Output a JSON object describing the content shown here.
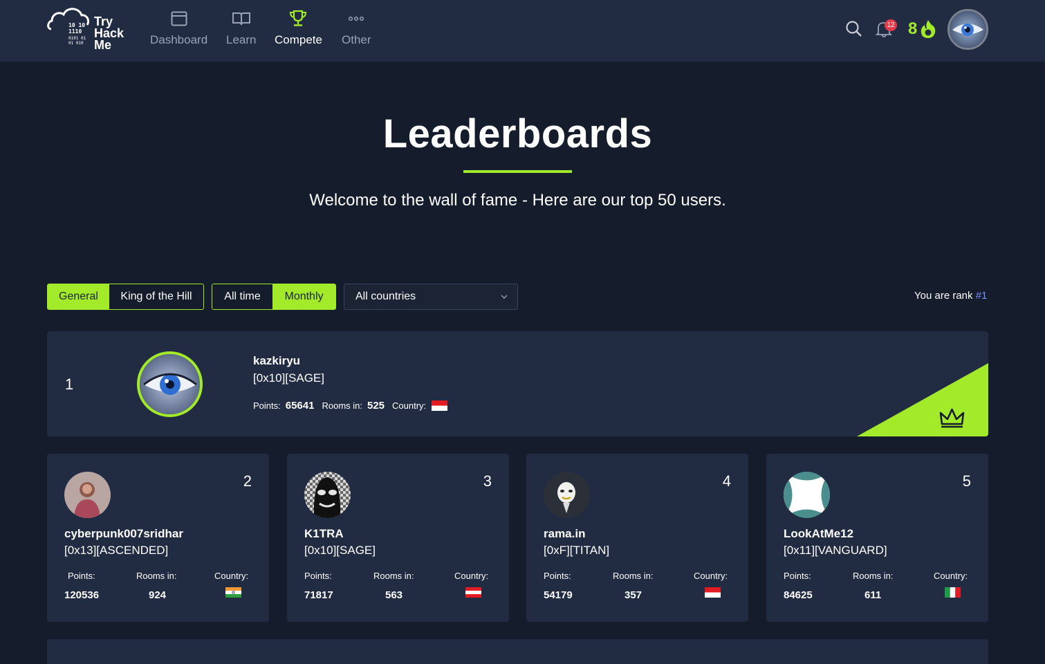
{
  "nav": {
    "logo_text": [
      "Try",
      "Hack",
      "Me"
    ],
    "items": [
      {
        "label": "Dashboard",
        "icon": "dashboard-icon",
        "active": false
      },
      {
        "label": "Learn",
        "icon": "book-icon",
        "active": false
      },
      {
        "label": "Compete",
        "icon": "trophy-icon",
        "active": true
      },
      {
        "label": "Other",
        "icon": "more-icon",
        "active": false
      }
    ],
    "notifications_count": "12",
    "streak": "8",
    "accent": "#a3ea2a"
  },
  "hero": {
    "title": "Leaderboards",
    "subtitle": "Welcome to the wall of fame - Here are our top 50 users."
  },
  "filters": {
    "type_options": [
      "General",
      "King of the Hill"
    ],
    "type_selected": "General",
    "period_options": [
      "All time",
      "Monthly"
    ],
    "period_selected": "Monthly",
    "country_selected": "All countries",
    "rank_prefix": "You are rank ",
    "rank_value": "#1"
  },
  "labels": {
    "points": "Points:",
    "rooms": "Rooms in:",
    "country": "Country:"
  },
  "leader": {
    "rank": "1",
    "username": "kazkiryu",
    "title": "[0x10][SAGE]",
    "points": "65641",
    "rooms": "525",
    "country_flag": "red-white"
  },
  "runners": [
    {
      "rank": "2",
      "username": "cyberpunk007sridhar",
      "title": "[0x13][ASCENDED]",
      "points": "120536",
      "rooms": "924",
      "country_flag": "india"
    },
    {
      "rank": "3",
      "username": "K1TRA",
      "title": "[0x10][SAGE]",
      "points": "71817",
      "rooms": "563",
      "country_flag": "austria"
    },
    {
      "rank": "4",
      "username": "rama.in",
      "title": "[0xF][TITAN]",
      "points": "54179",
      "rooms": "357",
      "country_flag": "red-white"
    },
    {
      "rank": "5",
      "username": "LookAtMe12",
      "title": "[0x11][VANGUARD]",
      "points": "84625",
      "rooms": "611",
      "country_flag": "italy"
    }
  ]
}
